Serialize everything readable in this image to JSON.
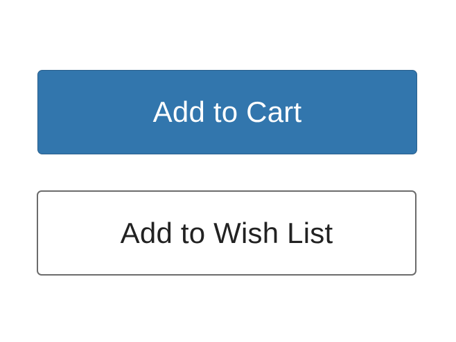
{
  "buttons": {
    "add_to_cart_label": "Add to Cart",
    "add_to_wish_list_label": "Add to Wish List"
  },
  "colors": {
    "primary_button_bg": "#3276ad",
    "primary_button_text": "#ffffff",
    "secondary_button_border": "#6b6b6b",
    "secondary_button_text": "#222222"
  }
}
